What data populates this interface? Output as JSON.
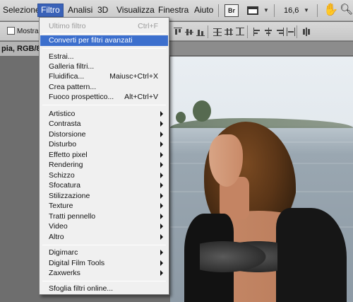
{
  "menubar": {
    "items": [
      "Selezione",
      "Filtro",
      "Analisi",
      "3D",
      "Visualizza",
      "Finestra",
      "Aiuto"
    ],
    "active": "Filtro",
    "br_label": "Br",
    "zoom": "16,6"
  },
  "options": {
    "show_label": "Mostra c"
  },
  "document": {
    "tab_title": "pia, RGB/8*"
  },
  "filter_menu": {
    "last_filter": {
      "label": "Ultimo filtro",
      "shortcut": "Ctrl+F"
    },
    "smart_filters": {
      "label": "Converti per filtri avanzati"
    },
    "group1": [
      {
        "label": "Estrai...",
        "shortcut": ""
      },
      {
        "label": "Galleria filtri...",
        "shortcut": ""
      },
      {
        "label": "Fluidifica...",
        "shortcut": "Maiusc+Ctrl+X"
      },
      {
        "label": "Crea pattern...",
        "shortcut": ""
      },
      {
        "label": "Fuoco prospettico...",
        "shortcut": "Alt+Ctrl+V"
      }
    ],
    "group2": [
      "Artistico",
      "Contrasta",
      "Distorsione",
      "Disturbo",
      "Effetto pixel",
      "Rendering",
      "Schizzo",
      "Sfocatura",
      "Stilizzazione",
      "Texture",
      "Tratti pennello",
      "Video",
      "Altro"
    ],
    "group3": [
      "Digimarc",
      "Digital Film Tools",
      "Zaxwerks"
    ],
    "browse_online": "Sfoglia filtri online..."
  },
  "colors": {
    "menu_highlight": "#3c6fcd",
    "active_menu": "#3a62b8"
  },
  "icons": [
    "screen-mode-icon",
    "hand-tool-icon",
    "zoom-tool-icon",
    "dropdown-arrow-icon",
    "submenu-arrow-icon"
  ]
}
